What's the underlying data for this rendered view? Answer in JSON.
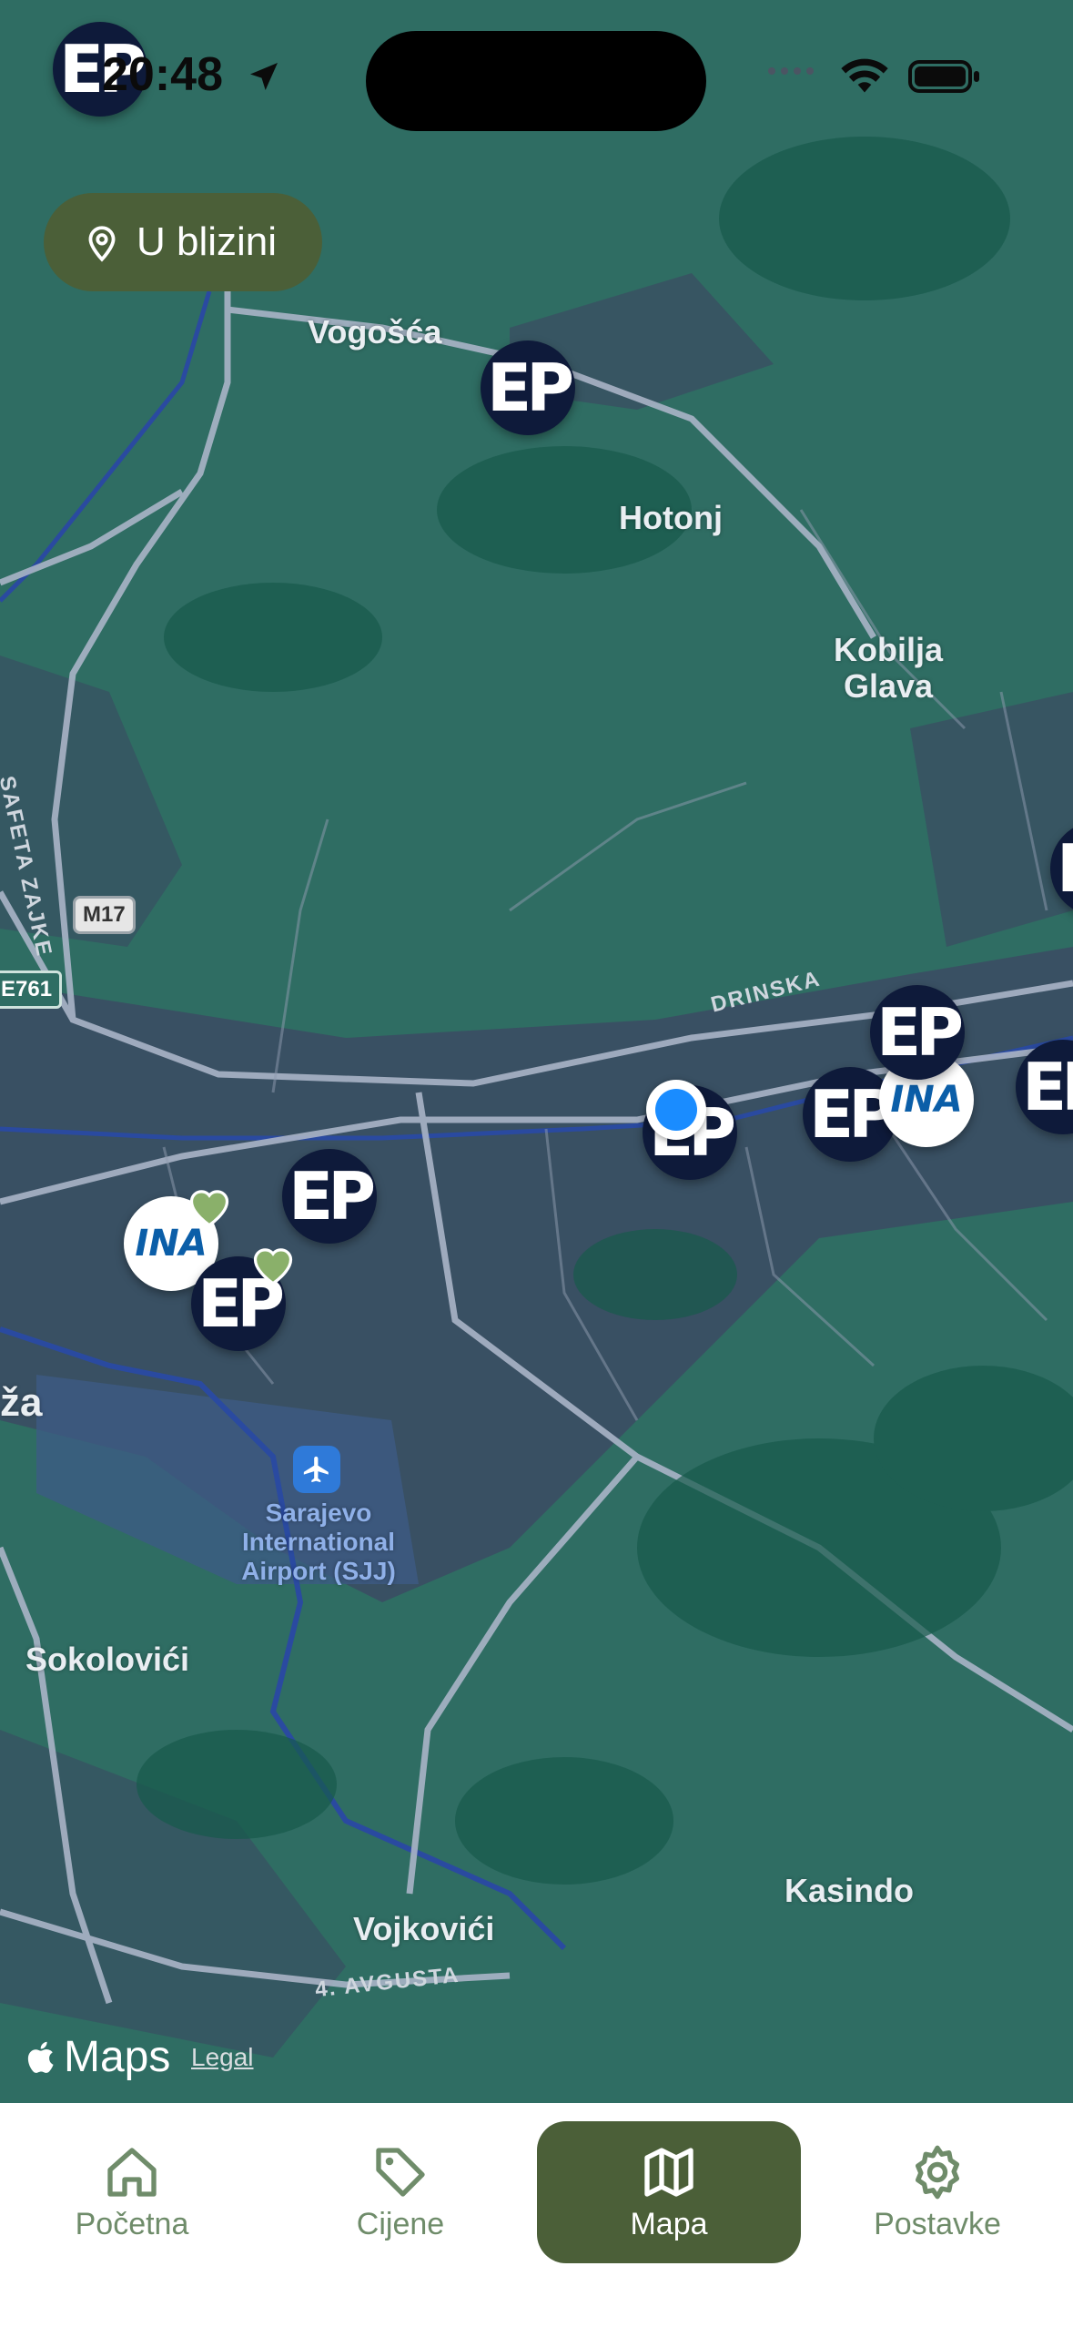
{
  "status_bar": {
    "time": "20:48"
  },
  "filter": {
    "label": "U blizini",
    "icon": "location-pin-icon"
  },
  "map": {
    "places": [
      {
        "id": "vogosca",
        "name": "Vogošća"
      },
      {
        "id": "hotonj",
        "name": "Hotonj"
      },
      {
        "id": "kobilja",
        "name": "Kobilja\nGlava"
      },
      {
        "id": "sokolovici",
        "name": "Sokolovići"
      },
      {
        "id": "kasindo",
        "name": "Kasindo"
      },
      {
        "id": "vojkovici",
        "name": "Vojkovići"
      },
      {
        "id": "za",
        "name": "ža"
      },
      {
        "id": "airport",
        "name": "Sarajevo\nInternational\nAirport (SJJ)"
      }
    ],
    "roads": [
      {
        "id": "safeta",
        "name": "SAFETA ZAJKE"
      },
      {
        "id": "drinska",
        "name": "DRINSKA"
      },
      {
        "id": "avgusta",
        "name": "4. AVGUSTA"
      }
    ],
    "shields": {
      "m17": "M17",
      "e761": "E761"
    },
    "markers": [
      {
        "brand": "EP",
        "favorite": false
      },
      {
        "brand": "EP",
        "favorite": false
      },
      {
        "brand": "EP",
        "favorite": false
      },
      {
        "brand": "INA",
        "favorite": true
      },
      {
        "brand": "EP",
        "favorite": true
      },
      {
        "brand": "EP",
        "favorite": false
      },
      {
        "brand": "EP",
        "favorite": false
      },
      {
        "brand": "INA",
        "favorite": false
      },
      {
        "brand": "EP",
        "favorite": false
      },
      {
        "brand": "EP",
        "favorite": false
      },
      {
        "brand": "EP",
        "favorite": false
      }
    ],
    "attribution": {
      "logo": "Maps",
      "legal": "Legal"
    }
  },
  "tabs": [
    {
      "label": "Početna",
      "icon": "home-icon",
      "active": false
    },
    {
      "label": "Cijene",
      "icon": "tag-icon",
      "active": false
    },
    {
      "label": "Mapa",
      "icon": "map-icon",
      "active": true
    },
    {
      "label": "Postavke",
      "icon": "gear-icon",
      "active": false
    }
  ],
  "colors": {
    "accent": "#4b5f38",
    "tab_inactive": "#6f8c6a",
    "ep_marker": "#0e1a3a",
    "ina_marker": "#0b5ea8",
    "user_location": "#1a8cff"
  }
}
